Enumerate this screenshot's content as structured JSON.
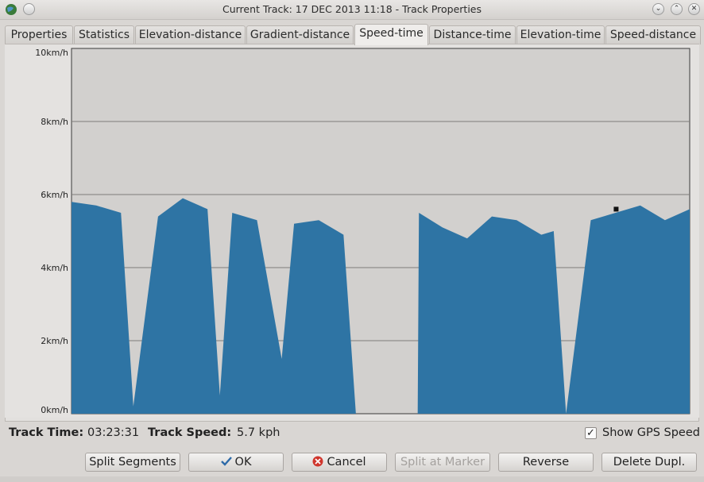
{
  "window": {
    "title": "Current Track: 17 DEC 2013 11:18 - Track Properties"
  },
  "tabs": [
    {
      "label": "Properties"
    },
    {
      "label": "Statistics"
    },
    {
      "label": "Elevation-distance"
    },
    {
      "label": "Gradient-distance"
    },
    {
      "label": "Speed-time"
    },
    {
      "label": "Distance-time"
    },
    {
      "label": "Elevation-time"
    },
    {
      "label": "Speed-distance"
    }
  ],
  "active_tab": "Speed-time",
  "chart_data": {
    "type": "area",
    "xlabel": "",
    "ylabel": "",
    "ylim": [
      0,
      10
    ],
    "y_ticks": [
      "0km/h",
      "2km/h",
      "4km/h",
      "6km/h",
      "8km/h",
      "10km/h"
    ],
    "grid": true,
    "colors": {
      "fill": "#2e74a4",
      "plot_bg": "#d2d0ce",
      "gutter": "#e4e2e0"
    },
    "x": [
      0,
      0.04,
      0.08,
      0.1,
      0.14,
      0.18,
      0.22,
      0.24,
      0.26,
      0.3,
      0.34,
      0.36,
      0.4,
      0.44,
      0.46,
      0.47,
      0.5,
      0.54,
      0.56,
      0.562,
      0.6,
      0.64,
      0.68,
      0.72,
      0.76,
      0.78,
      0.8,
      0.84,
      0.88,
      0.92,
      0.96,
      1.0
    ],
    "values": [
      5.8,
      5.7,
      5.5,
      0.2,
      5.4,
      5.9,
      5.6,
      0.5,
      5.5,
      5.3,
      1.5,
      5.2,
      5.3,
      4.9,
      0.0,
      0.0,
      0.0,
      0.0,
      0.0,
      5.5,
      5.1,
      4.8,
      5.4,
      5.3,
      4.9,
      5.0,
      0.0,
      5.3,
      5.5,
      5.7,
      5.3,
      5.6
    ],
    "marker": {
      "x": 0.881,
      "y": 5.6
    }
  },
  "status": {
    "track_time_label": "Track Time:",
    "track_time_value": "03:23:31",
    "track_speed_label": "Track Speed:",
    "track_speed_value": "5.7 kph",
    "show_gps_speed_label": "Show GPS Speed",
    "show_gps_speed_checked": "✓"
  },
  "buttons": {
    "split_segments": "Split Segments",
    "ok": "OK",
    "cancel": "Cancel",
    "split_at_marker": "Split at Marker",
    "reverse": "Reverse",
    "delete_dupl": "Delete Dupl."
  }
}
